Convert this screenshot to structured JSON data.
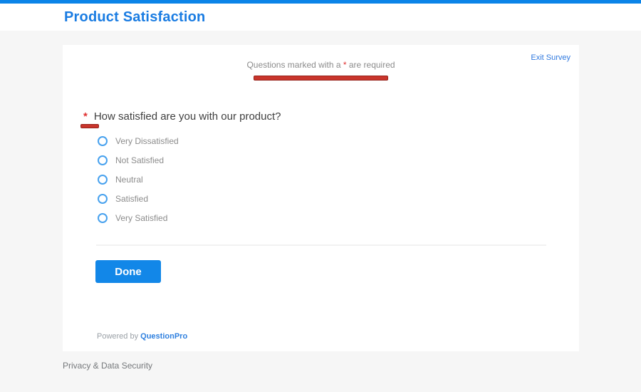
{
  "colors": {
    "accent_blue": "#0b84e8",
    "title_blue": "#1a7ce2",
    "link_blue": "#3079df",
    "button_blue": "#1287e8",
    "radio_blue": "#47a1ee",
    "annotation_red_fill": "#c9352c",
    "annotation_red_border": "#97231b",
    "page_background": "#f6f6f6"
  },
  "header": {
    "title": "Product Satisfaction"
  },
  "survey": {
    "exit_link": "Exit Survey",
    "required_note": {
      "prefix": "Questions marked with a ",
      "asterisk": "*",
      "suffix": " are required"
    },
    "question": {
      "required_marker": "*",
      "text": "How satisfied are you with our product?"
    },
    "options": [
      {
        "label": "Very Dissatisfied"
      },
      {
        "label": "Not Satisfied"
      },
      {
        "label": "Neutral"
      },
      {
        "label": "Satisfied"
      },
      {
        "label": "Very Satisfied"
      }
    ],
    "done_button": "Done",
    "powered_by": {
      "prefix": "Powered by ",
      "brand": "QuestionPro"
    }
  },
  "footer": {
    "privacy_link": "Privacy & Data Security"
  }
}
